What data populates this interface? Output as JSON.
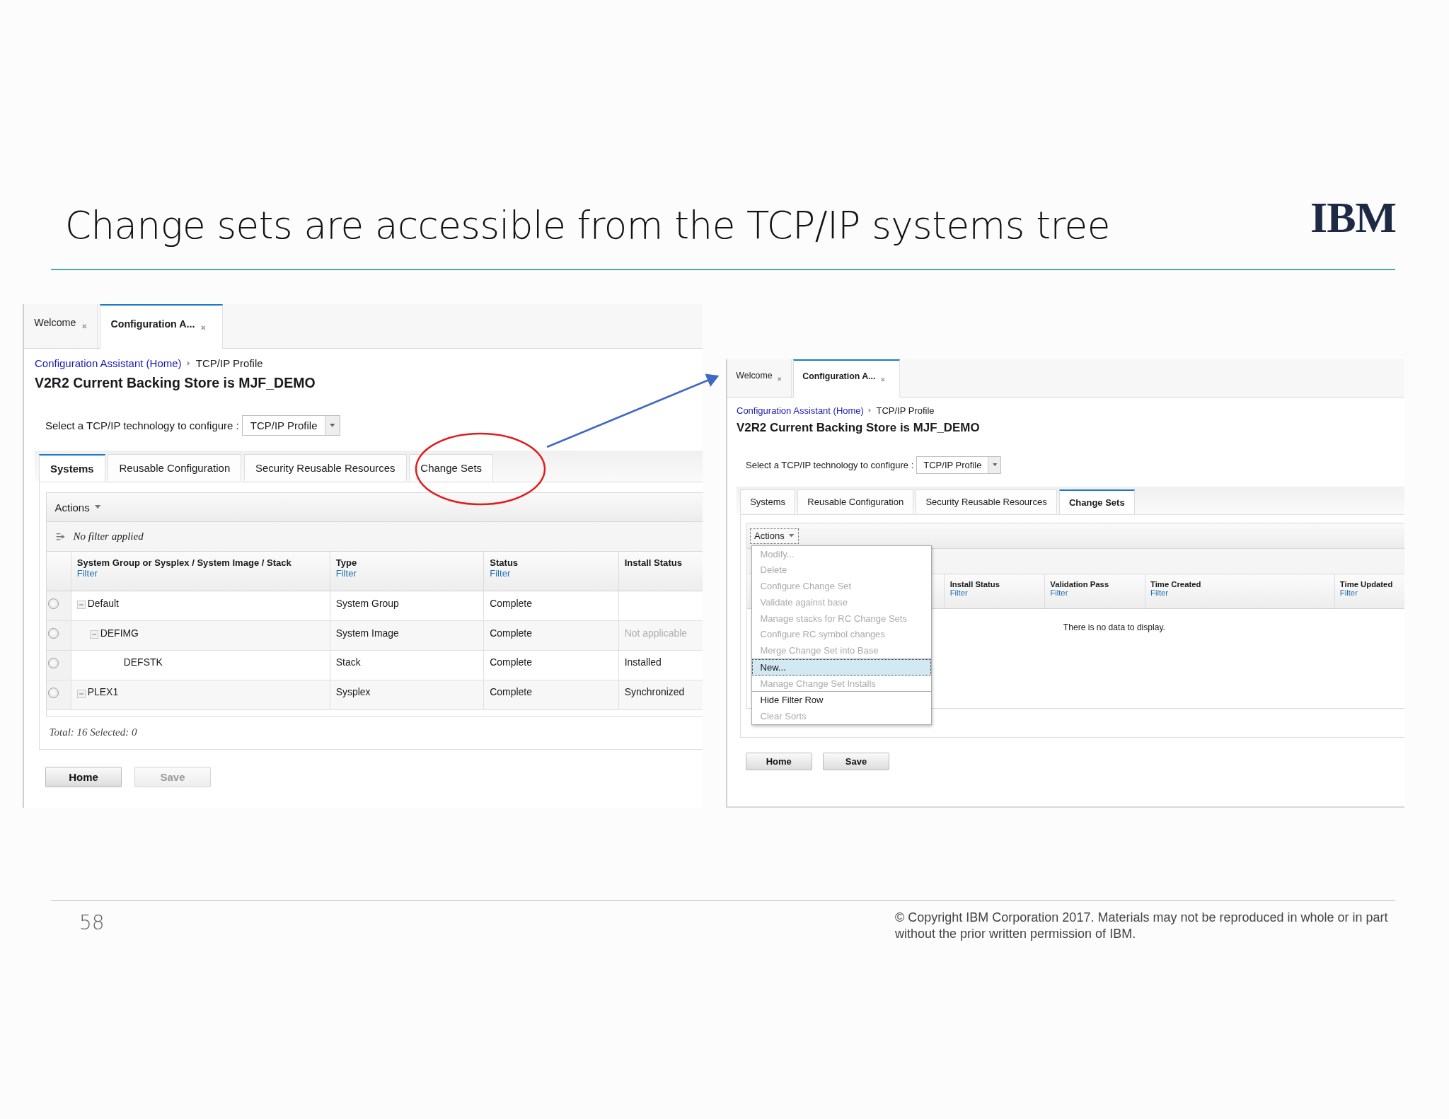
{
  "slide": {
    "title": "Change sets are accessible from the TCP/IP systems tree",
    "logo": "IBM",
    "page_number": "58",
    "copyright": "© Copyright IBM Corporation 2017.  Materials may not be reproduced in whole or in part without the prior written permission of IBM."
  },
  "panels": [
    {
      "tabs": [
        {
          "label": "Welcome",
          "selected": false
        },
        {
          "label": "Configuration A...",
          "selected": true
        }
      ],
      "breadcrumb": {
        "link": "Configuration Assistant (Home)",
        "current": "TCP/IP Profile"
      },
      "heading": "V2R2 Current Backing Store is MJF_DEMO",
      "select": {
        "label": "Select a TCP/IP technology to configure :",
        "value": "TCP/IP Profile"
      },
      "view_tabs": [
        {
          "label": "Systems",
          "selected": true
        },
        {
          "label": "Reusable Configuration",
          "selected": false
        },
        {
          "label": "Security Reusable Resources",
          "selected": false
        },
        {
          "label": "Change Sets",
          "selected": false
        }
      ],
      "actions": "Actions",
      "filter_status": "No filter applied",
      "table": {
        "columns": [
          {
            "title": "System Group or Sysplex / System Image / Stack",
            "filter": "Filter"
          },
          {
            "title": "Type",
            "filter": "Filter"
          },
          {
            "title": "Status",
            "filter": "Filter"
          },
          {
            "title": "Install Status"
          }
        ],
        "rows": [
          {
            "name": "Default",
            "expanded": true,
            "selected": false,
            "type": "System Group",
            "status": "Complete",
            "children": [
              {
                "name": "DEFIMG",
                "expanded": true,
                "selected": false,
                "type": "System Image",
                "status": "Complete",
                "install_status": {
                  "text": "Not applicable",
                  "disabled": true
                },
                "children": [
                  {
                    "name": "DEFSTK",
                    "selected": false,
                    "type": "Stack",
                    "status": "Complete",
                    "install_status": {
                      "text": "Installed",
                      "disabled": false
                    }
                  }
                ]
              }
            ]
          },
          {
            "name": "PLEX1",
            "expanded": true,
            "selected": false,
            "type": "Sysplex",
            "status": "Complete",
            "install_status": {
              "text": "Synchronized",
              "disabled": false
            }
          }
        ]
      },
      "total": "Total: 16 Selected: 0",
      "buttons": [
        {
          "label": "Home",
          "disabled": false
        },
        {
          "label": "Save",
          "disabled": true
        }
      ]
    },
    {
      "tabs": [
        {
          "label": "Welcome",
          "selected": false
        },
        {
          "label": "Configuration A...",
          "selected": true
        }
      ],
      "breadcrumb": {
        "link": "Configuration Assistant (Home)",
        "current": "TCP/IP Profile"
      },
      "heading": "V2R2 Current Backing Store is MJF_DEMO",
      "select": {
        "label": "Select a TCP/IP technology to configure :",
        "value": "TCP/IP Profile"
      },
      "view_tabs": [
        {
          "label": "Systems",
          "selected": false
        },
        {
          "label": "Reusable Configuration",
          "selected": false
        },
        {
          "label": "Security Reusable Resources",
          "selected": false
        },
        {
          "label": "Change Sets",
          "selected": true
        }
      ],
      "actions": "Actions",
      "menu": {
        "groups": [
          [
            {
              "label": "Modify...",
              "disabled": true,
              "selected": false
            },
            {
              "label": "Delete",
              "disabled": true,
              "selected": false
            },
            {
              "label": "Configure Change Set",
              "disabled": true,
              "selected": false
            },
            {
              "label": "Validate against base",
              "disabled": true,
              "selected": false
            },
            {
              "label": "Manage stacks for RC Change Sets",
              "disabled": true,
              "selected": false
            },
            {
              "label": "Configure RC symbol changes",
              "disabled": true,
              "selected": false
            },
            {
              "label": "Merge Change Set into Base",
              "disabled": true,
              "selected": false
            }
          ],
          [
            {
              "label": "New...",
              "disabled": false,
              "selected": true
            },
            {
              "label": "Manage Change Set Installs",
              "disabled": true,
              "selected": false
            }
          ],
          [
            {
              "label": "Hide Filter Row",
              "disabled": false,
              "selected": false
            },
            {
              "label": "Clear Sorts",
              "disabled": true,
              "selected": false
            }
          ]
        ]
      },
      "table": {
        "columns": [
          {
            "title": "Install Status",
            "filter": "Filter"
          },
          {
            "title": "Validation Pass",
            "filter": "Filter"
          },
          {
            "title": "Time Created",
            "filter": "Filter"
          },
          {
            "title": "Time Updated",
            "filter": "Filter"
          }
        ]
      },
      "empty_message": "There is no data to display.",
      "buttons": [
        {
          "label": "Home",
          "disabled": false
        },
        {
          "label": "Save",
          "disabled": false
        }
      ]
    }
  ]
}
